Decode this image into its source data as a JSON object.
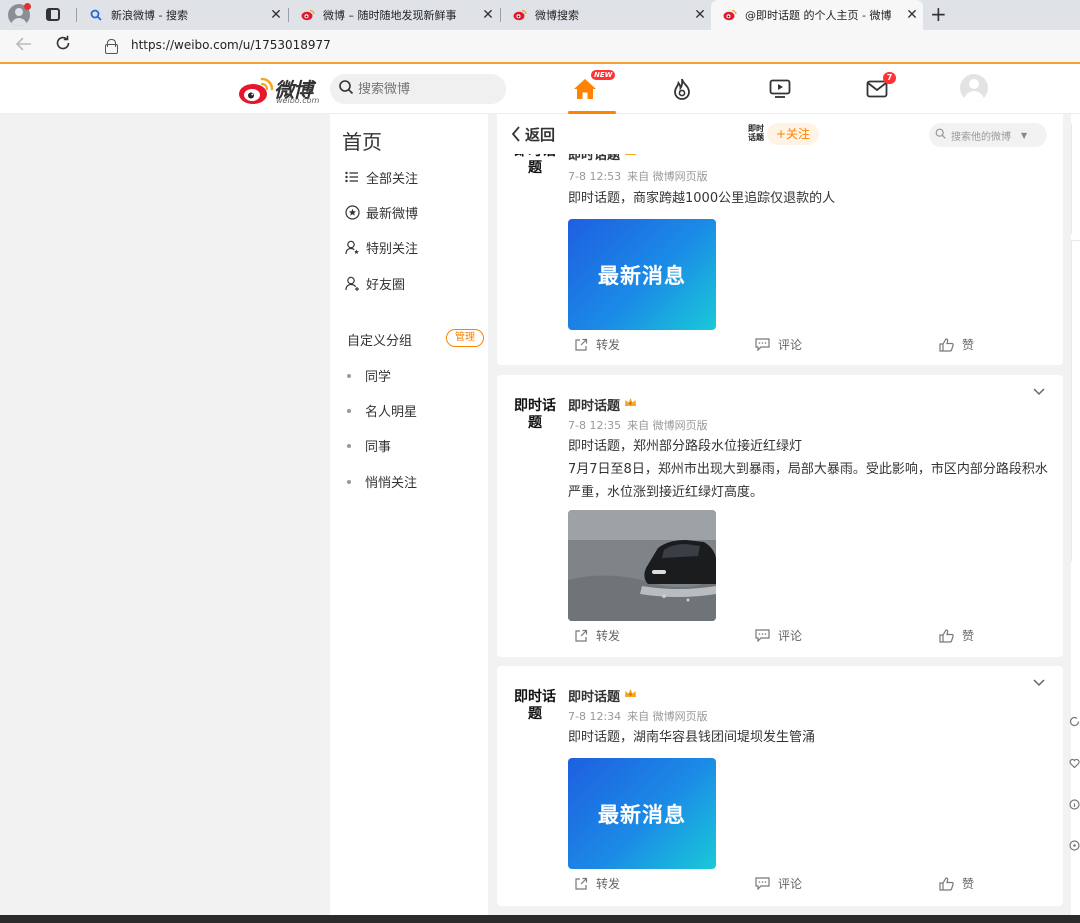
{
  "browser": {
    "tabs": [
      {
        "title": "新浪微博 - 搜索",
        "icon": "search-icon",
        "active": false
      },
      {
        "title": "微博 – 随时随地发现新鲜事",
        "icon": "weibo-icon",
        "active": false
      },
      {
        "title": "微博搜索",
        "icon": "weibo-icon",
        "active": false
      },
      {
        "title": "@即时话题 的个人主页 - 微博",
        "icon": "weibo-icon",
        "active": true
      }
    ],
    "url": "https://weibo.com/u/1753018977",
    "accent": "#f89e33"
  },
  "header": {
    "logo_text": "微博",
    "logo_sub": "weibo.com",
    "search_placeholder": "搜索微博",
    "new_badge": "NEW",
    "mail_count": "7",
    "accent": "#ff8200"
  },
  "leftnav": {
    "title": "首页",
    "items": [
      {
        "label": "全部关注",
        "icon": "list-icon"
      },
      {
        "label": "最新微博",
        "icon": "star-circle-icon"
      },
      {
        "label": "特别关注",
        "icon": "user-star-icon"
      },
      {
        "label": "好友圈",
        "icon": "user-group-icon"
      }
    ],
    "group_title": "自定义分组",
    "manage_label": "管理",
    "groups": [
      "同学",
      "名人明星",
      "同事",
      "悄悄关注"
    ]
  },
  "topbar": {
    "back_label": "返回",
    "mini_avatar": "即时话题",
    "follow_label": "+关注",
    "search_placeholder": "搜索他的微博"
  },
  "posts": [
    {
      "avatar": "即时话题",
      "author": "即时话题",
      "time": "7-8 12:53",
      "source": "来自 微博网页版",
      "text": "即时话题，商家跨越1000公里追踪仅退款的人",
      "image": "news",
      "image_text": "最新消息",
      "repost": "转发",
      "comment": "评论",
      "like": "赞"
    },
    {
      "avatar": "即时话题",
      "author": "即时话题",
      "time": "7-8 12:35",
      "source": "来自 微博网页版",
      "text": "即时话题，郑州部分路段水位接近红绿灯\n7月7日至8日，郑州市出现大到暴雨，局部大暴雨。受此影响，市区内部分路段积水严重，水位涨到接近红绿灯高度。",
      "image": "car",
      "image_text": "",
      "repost": "转发",
      "comment": "评论",
      "like": "赞"
    },
    {
      "avatar": "即时话题",
      "author": "即时话题",
      "time": "7-8 12:34",
      "source": "来自 微博网页版",
      "text": "即时话题，湖南华容县钱团间堤坝发生管涌",
      "image": "news",
      "image_text": "最新消息",
      "repost": "转发",
      "comment": "评论",
      "like": "赞"
    }
  ]
}
